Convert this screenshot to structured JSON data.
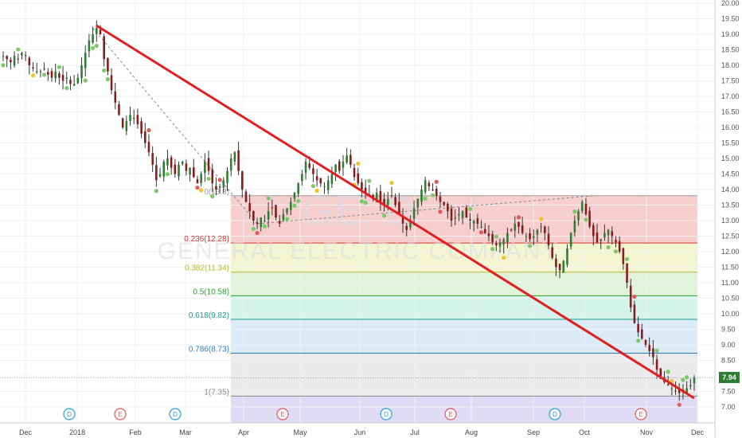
{
  "chart_data": {
    "type": "candlestick",
    "watermark": {
      "symbol": "GE, D",
      "company": "GENERAL ELECTRIC COMPANY"
    },
    "last_price": "7.94",
    "ylim": [
      6.9,
      20.1
    ],
    "y_ticks": [
      "7.00",
      "7.50",
      "8.00",
      "8.50",
      "9.00",
      "9.50",
      "10.00",
      "10.50",
      "11.00",
      "11.50",
      "12.00",
      "12.50",
      "13.00",
      "13.50",
      "14.00",
      "14.50",
      "15.00",
      "15.50",
      "16.00",
      "16.50",
      "17.00",
      "17.50",
      "18.00",
      "18.50",
      "19.00",
      "19.50",
      "20.00"
    ],
    "x_labels": [
      "Dec",
      "2018",
      "Feb",
      "Mar",
      "Apr",
      "May",
      "Jun",
      "Jul",
      "Aug",
      "Sep",
      "Oct",
      "Nov",
      "Dec"
    ],
    "fibonacci": [
      {
        "label": "0(13.8)",
        "value": 13.8,
        "color": "#9e9e9e",
        "fill": "#f5c6c6"
      },
      {
        "label": "0.236(12.28)",
        "value": 12.28,
        "color": "#d32f2f",
        "fill": "#f1f3c8"
      },
      {
        "label": "0.382(11.34)",
        "value": 11.34,
        "color": "#b5b82a",
        "fill": "#dcf2d2"
      },
      {
        "label": "0.5(10.58)",
        "value": 10.58,
        "color": "#2e9e2e",
        "fill": "#cdf1e6"
      },
      {
        "label": "0.618(9.82)",
        "value": 9.82,
        "color": "#1a9e85",
        "fill": "#d3e6f6"
      },
      {
        "label": "0.786(8.73)",
        "value": 8.73,
        "color": "#2a7fc0",
        "fill": "#e6e6e6"
      },
      {
        "label": "1(7.35)",
        "value": 7.35,
        "color": "#888888",
        "fill": "#d9d5f3"
      }
    ],
    "events": [
      {
        "label": "D",
        "kind": "dividend",
        "x_index": 18
      },
      {
        "label": "E",
        "kind": "earnings",
        "x_index": 38
      },
      {
        "label": "D",
        "kind": "dividend",
        "x_index": 56
      },
      {
        "label": "E",
        "kind": "earnings",
        "x_index": 87
      },
      {
        "label": "D",
        "kind": "dividend",
        "x_index": 121
      },
      {
        "label": "E",
        "kind": "earnings",
        "x_index": 141
      },
      {
        "label": "D",
        "kind": "dividend",
        "x_index": 181
      },
      {
        "label": "E",
        "kind": "earnings",
        "x_index": 206
      }
    ],
    "series": [
      {
        "name": "GE",
        "closes": [
          18.3,
          18.2,
          18.1,
          18.3,
          18.2,
          18.4,
          18.3,
          18.0,
          17.9,
          17.8,
          17.8,
          17.9,
          17.7,
          17.6,
          17.8,
          17.6,
          17.5,
          17.6,
          17.4,
          17.4,
          17.6,
          18.0,
          18.4,
          18.8,
          19.0,
          19.2,
          19.0,
          18.2,
          17.8,
          17.2,
          16.8,
          16.4,
          16.0,
          16.2,
          16.4,
          16.3,
          16.1,
          15.8,
          15.5,
          15.2,
          14.8,
          14.3,
          14.5,
          14.9,
          15.0,
          14.7,
          14.5,
          14.8,
          14.9,
          14.6,
          14.7,
          14.4,
          14.2,
          14.5,
          14.9,
          14.6,
          14.2,
          14.0,
          14.1,
          14.3,
          14.6,
          15.0,
          15.2,
          14.6,
          14.0,
          13.6,
          13.3,
          13.0,
          12.9,
          13.1,
          13.0,
          13.3,
          13.4,
          13.1,
          12.9,
          13.2,
          13.4,
          13.6,
          13.9,
          14.2,
          14.5,
          14.9,
          14.7,
          14.5,
          14.3,
          14.2,
          14.1,
          14.3,
          14.5,
          14.8,
          14.6,
          14.9,
          15.1,
          14.8,
          14.4,
          14.2,
          14.0,
          13.9,
          13.8,
          13.7,
          13.9,
          13.6,
          13.5,
          13.7,
          13.8,
          13.5,
          13.2,
          12.9,
          12.7,
          13.0,
          13.4,
          13.7,
          14.0,
          14.3,
          14.1,
          14.0,
          13.8,
          13.6,
          13.5,
          13.3,
          13.0,
          13.1,
          13.2,
          13.3,
          13.1,
          13.0,
          13.0,
          12.9,
          12.8,
          12.6,
          12.5,
          12.3,
          12.2,
          12.3,
          12.4,
          12.6,
          12.7,
          12.9,
          12.8,
          12.6,
          12.5,
          12.4,
          12.5,
          12.7,
          12.8,
          12.6,
          12.2,
          11.8,
          11.5,
          11.4,
          11.7,
          12.1,
          12.6,
          13.0,
          13.3,
          13.6,
          13.2,
          12.8,
          12.5,
          12.3,
          12.4,
          12.6,
          12.7,
          12.5,
          12.3,
          12.0,
          11.6,
          11.0,
          10.2,
          9.7,
          9.4,
          9.2,
          9.0,
          8.8,
          8.6,
          8.2,
          7.9,
          7.8,
          7.7,
          7.6,
          7.5,
          7.45,
          7.5,
          7.6,
          7.7,
          7.94
        ]
      }
    ]
  }
}
